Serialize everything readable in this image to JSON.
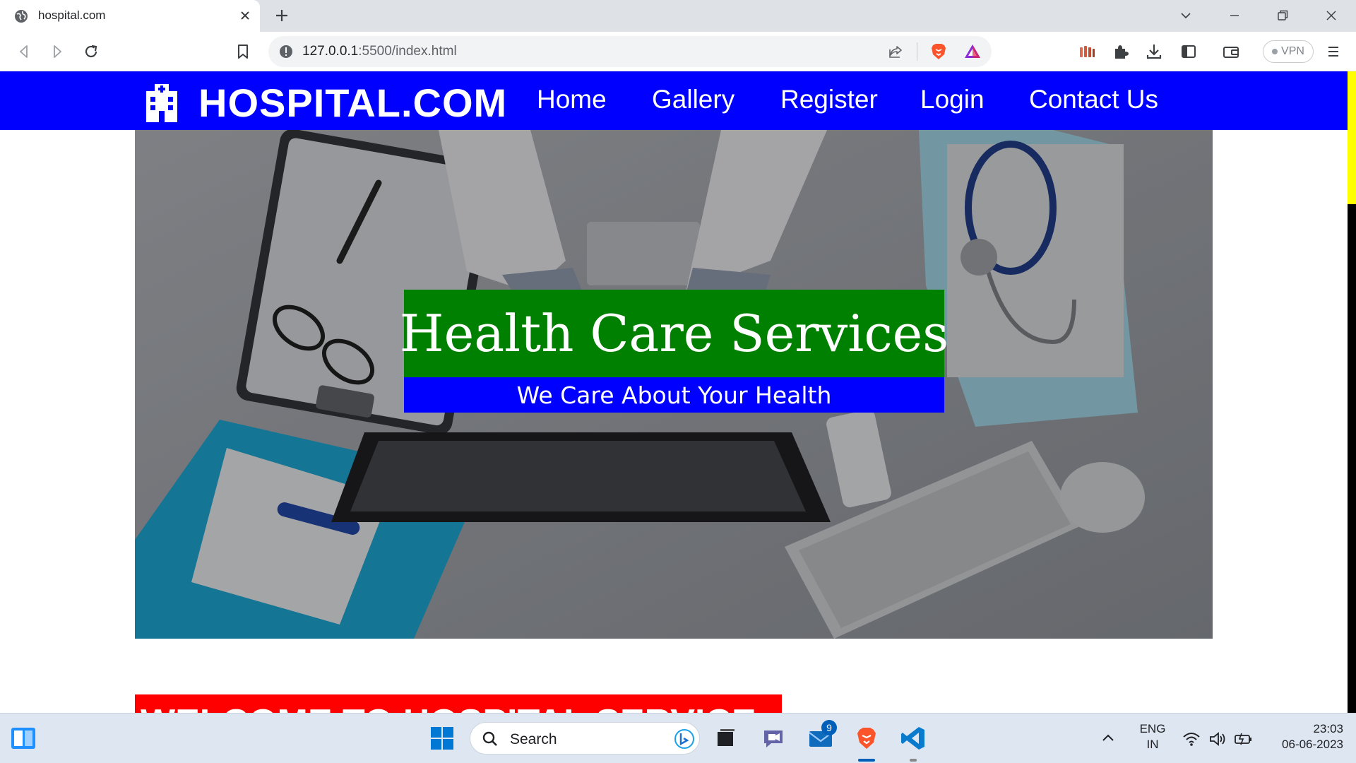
{
  "browser": {
    "tab_title": "hospital.com",
    "url_host": "127.0.0.1",
    "url_path": ":5500/index.html",
    "vpn_label": "VPN"
  },
  "site": {
    "brand": "HOSPITAL.COM",
    "nav": [
      {
        "label": "Home"
      },
      {
        "label": "Gallery"
      },
      {
        "label": "Register"
      },
      {
        "label": "Login"
      },
      {
        "label": "Contact Us"
      }
    ],
    "hero_title": "Health Care Services",
    "hero_subtitle": "We Care About Your Health",
    "welcome_banner": "WELCOME TO HOSPITAL SERVICE"
  },
  "colors": {
    "navbar": "#0000ff",
    "hero_title_bg": "#008000",
    "hero_subtitle_bg": "#0000ff",
    "welcome_bg": "#ff0000",
    "scrollbar_track": "#ffff00",
    "scrollbar_thumb": "#000000"
  },
  "taskbar": {
    "search_placeholder": "Search",
    "mail_badge": "9",
    "lang_line1": "ENG",
    "lang_line2": "IN",
    "time": "23:03",
    "date": "06-06-2023"
  },
  "icons": [
    "globe-icon",
    "close-icon",
    "plus-icon",
    "chevron-down-icon",
    "minimize-icon",
    "restore-icon",
    "back-icon",
    "forward-icon",
    "reload-icon",
    "bookmark-icon",
    "info-icon",
    "share-icon",
    "brave-lion-icon",
    "brave-rewards-icon",
    "puzzle-icon",
    "download-icon",
    "sidebar-icon",
    "wallet-icon",
    "menu-icon",
    "hospital-building-icon",
    "widgets-icon",
    "windows-start-icon",
    "search-icon",
    "bing-icon",
    "task-view-icon",
    "teams-chat-icon",
    "mail-icon",
    "brave-taskbar-icon",
    "vscode-icon",
    "tray-chevron-icon",
    "wifi-icon",
    "volume-icon",
    "battery-icon"
  ]
}
